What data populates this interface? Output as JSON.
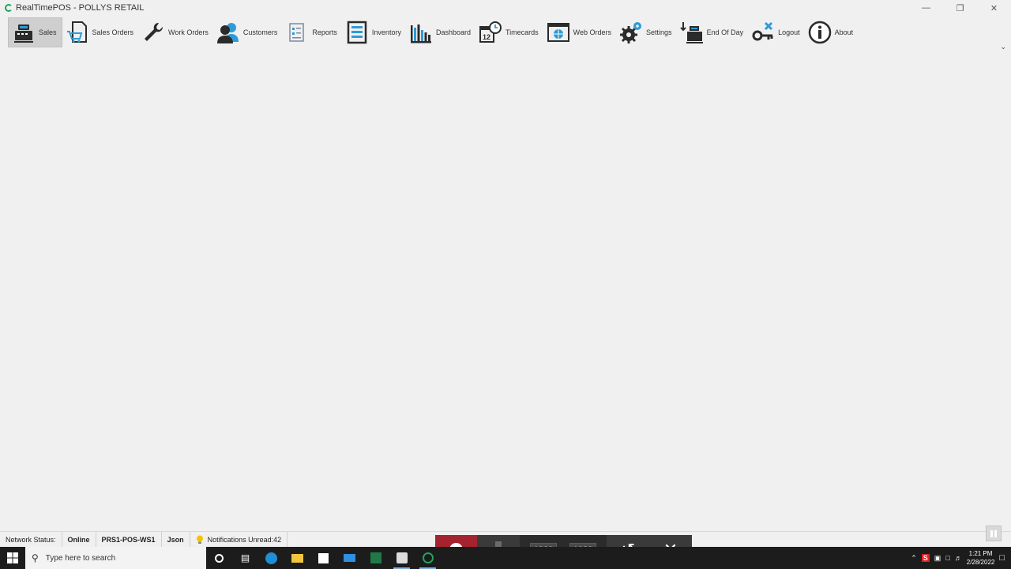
{
  "window": {
    "title": "RealTimePOS - POLLYS RETAIL"
  },
  "ribbon": [
    {
      "key": "sales",
      "label": "Sales",
      "icon": "cash-register-icon",
      "active": true
    },
    {
      "key": "sales-orders",
      "label": "Sales Orders",
      "icon": "document-cart-icon"
    },
    {
      "key": "work-orders",
      "label": "Work Orders",
      "icon": "wrench-icon"
    },
    {
      "key": "customers",
      "label": "Customers",
      "icon": "people-icon"
    },
    {
      "key": "reports",
      "label": "Reports",
      "icon": "report-icon"
    },
    {
      "key": "inventory",
      "label": "Inventory",
      "icon": "inventory-list-icon"
    },
    {
      "key": "dashboard",
      "label": "Dashboard",
      "icon": "bar-chart-icon"
    },
    {
      "key": "timecards",
      "label": "Timecards",
      "icon": "calendar-clock-icon"
    },
    {
      "key": "web-orders",
      "label": "Web Orders",
      "icon": "globe-window-icon"
    },
    {
      "key": "settings",
      "label": "Settings",
      "icon": "gears-icon"
    },
    {
      "key": "end-of-day",
      "label": "End Of Day",
      "icon": "register-down-icon"
    },
    {
      "key": "logout",
      "label": "Logout",
      "icon": "key-x-icon"
    },
    {
      "key": "about",
      "label": "About",
      "icon": "info-icon"
    }
  ],
  "statusbar": {
    "network_label": "Network Status:",
    "network_value": "Online",
    "workstation": "PRS1-POS-WS1",
    "format": "Json",
    "notifications": "Notifications Unread:42"
  },
  "recorder": {
    "width": "1920",
    "x": "x",
    "height": "1080"
  },
  "taskbar": {
    "search_placeholder": "Type here to search",
    "time": "1:21 PM",
    "date": "2/28/2022"
  },
  "colors": {
    "accent_blue": "#2e9bd6",
    "icon_dark": "#2b2b2b",
    "record_red": "#a4232e"
  }
}
